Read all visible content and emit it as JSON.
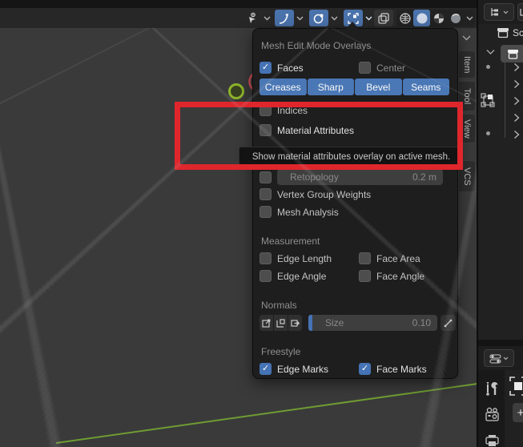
{
  "colors": {
    "accent": "#4772b3",
    "highlight_red": "#df262c",
    "viewport_bg": "#3a3a3a",
    "panel_bg": "#1e1e1e",
    "axis_green": "#6f9c33",
    "cursor_green": "#8db32a",
    "arc_red": "#cf4e57"
  },
  "toolbar": {
    "icon_names": [
      "cursor-visibility",
      "proportional-falloff",
      "snap-sphere",
      "overlays",
      "xray-toggle",
      "wireframe-shading",
      "solid-shading",
      "material-shading",
      "rendered-shading"
    ]
  },
  "overlay_panel": {
    "title": "Mesh Edit Mode Overlays",
    "faces": "Faces",
    "center": "Center",
    "edge_buttons": [
      "Creases",
      "Sharp",
      "Bevel",
      "Seams"
    ],
    "indices": "Indices",
    "material_attributes": "Material Attributes",
    "retopology_label": "Retopology",
    "retopology_value": "0.2 m",
    "vertex_group_weights": "Vertex Group Weights",
    "mesh_analysis": "Mesh Analysis",
    "measurement_title": "Measurement",
    "edge_length": "Edge Length",
    "face_area": "Face Area",
    "edge_angle": "Edge Angle",
    "face_angle": "Face Angle",
    "normals_title": "Normals",
    "size_label": "Size",
    "size_value": "0.10",
    "freestyle_title": "Freestyle",
    "edge_marks": "Edge Marks",
    "face_marks": "Face Marks"
  },
  "tooltip": "Show material attributes overlay on active mesh.",
  "sidebar_tabs": [
    "Item",
    "Tool",
    "View",
    "VCS"
  ],
  "outliner": {
    "scene_label": "Sc"
  },
  "properties": {
    "plus_label": "+"
  }
}
